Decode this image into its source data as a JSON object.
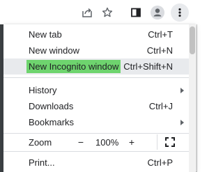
{
  "toolbar": {
    "share_icon": "share-icon",
    "bookmark_icon": "star-icon",
    "side_panel_icon": "side-panel-icon",
    "profile_icon": "profile-icon",
    "menu_icon": "kebab-menu-icon"
  },
  "menu": {
    "items": [
      {
        "label": "New tab",
        "shortcut": "Ctrl+T"
      },
      {
        "label": "New window",
        "shortcut": "Ctrl+N"
      },
      {
        "label": "New Incognito window",
        "shortcut": "Ctrl+Shift+N"
      },
      {
        "label": "History",
        "shortcut": ""
      },
      {
        "label": "Downloads",
        "shortcut": "Ctrl+J"
      },
      {
        "label": "Bookmarks",
        "shortcut": ""
      },
      {
        "label": "Print...",
        "shortcut": "Ctrl+P"
      }
    ],
    "zoom": {
      "label": "Zoom",
      "minus": "−",
      "value": "100%",
      "plus": "+"
    }
  },
  "colors": {
    "highlight": "#6ed46e",
    "text": "#202124",
    "icon": "#5f6368"
  }
}
